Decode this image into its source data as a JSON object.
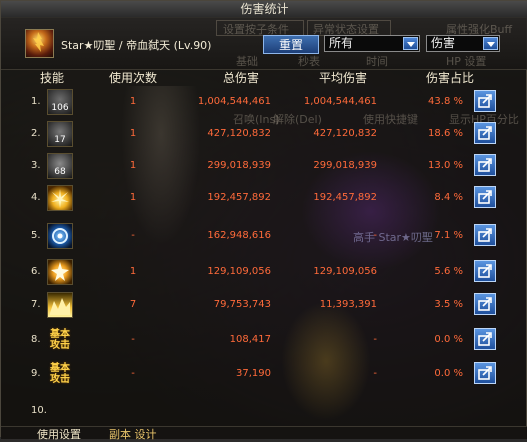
{
  "window": {
    "title": "伤害统计"
  },
  "header": {
    "character": "Star★叨聖 / 帝血弑天 (Lv.90)",
    "reset_label": "重置",
    "filter_select": "所有",
    "metric_select": "伤害",
    "background_text": {
      "settings_btn": "设置按子条件",
      "status_btn": "异常状态设置",
      "attr": "属性强化Buff",
      "basic": "基础",
      "seconds": "秒表",
      "time": "时间",
      "hp": "HP 设置"
    }
  },
  "columns": {
    "skill": "技能",
    "uses": "使用次数",
    "total": "总伤害",
    "avg": "平均伤害",
    "share": "伤害占比"
  },
  "rows": [
    {
      "index": "1.",
      "badge": "106",
      "uses": "1",
      "total": "1,004,544,461",
      "avg": "1,004,544,461",
      "pct": "43.8 %"
    },
    {
      "index": "2.",
      "badge": "17",
      "uses": "1",
      "total": "427,120,832",
      "avg": "427,120,832",
      "pct": "18.6 %"
    },
    {
      "index": "3.",
      "badge": "68",
      "uses": "1",
      "total": "299,018,939",
      "avg": "299,018,939",
      "pct": "13.0 %"
    },
    {
      "index": "4.",
      "badge": "",
      "uses": "1",
      "total": "192,457,892",
      "avg": "192,457,892",
      "pct": "8.4 %"
    },
    {
      "index": "5.",
      "badge": "",
      "uses": "-",
      "total": "162,948,616",
      "avg": "-",
      "pct": "7.1 %"
    },
    {
      "index": "6.",
      "badge": "",
      "uses": "1",
      "total": "129,109,056",
      "avg": "129,109,056",
      "pct": "5.6 %"
    },
    {
      "index": "7.",
      "badge": "",
      "uses": "7",
      "total": "79,753,743",
      "avg": "11,393,391",
      "pct": "3.5 %"
    },
    {
      "index": "8.",
      "badge": "基本\n攻击",
      "uses": "-",
      "total": "108,417",
      "avg": "-",
      "pct": "0.0 %"
    },
    {
      "index": "9.",
      "badge": "基本\n攻击",
      "uses": "-",
      "total": "37,190",
      "avg": "-",
      "pct": "0.0 %"
    },
    {
      "index": "10.",
      "badge": "",
      "uses": "",
      "total": "",
      "avg": "",
      "pct": ""
    }
  ],
  "background_misc": {
    "hotkey_ins": "召唤(Ins)",
    "hotkey_del": "解除(Del)",
    "use_hotkey": "使用快捷键",
    "show_hp": "显示HP百分比",
    "player_label": "高手 Star★叨聖"
  },
  "footer": {
    "item1": "使用设置",
    "item2": "副本 设计"
  }
}
